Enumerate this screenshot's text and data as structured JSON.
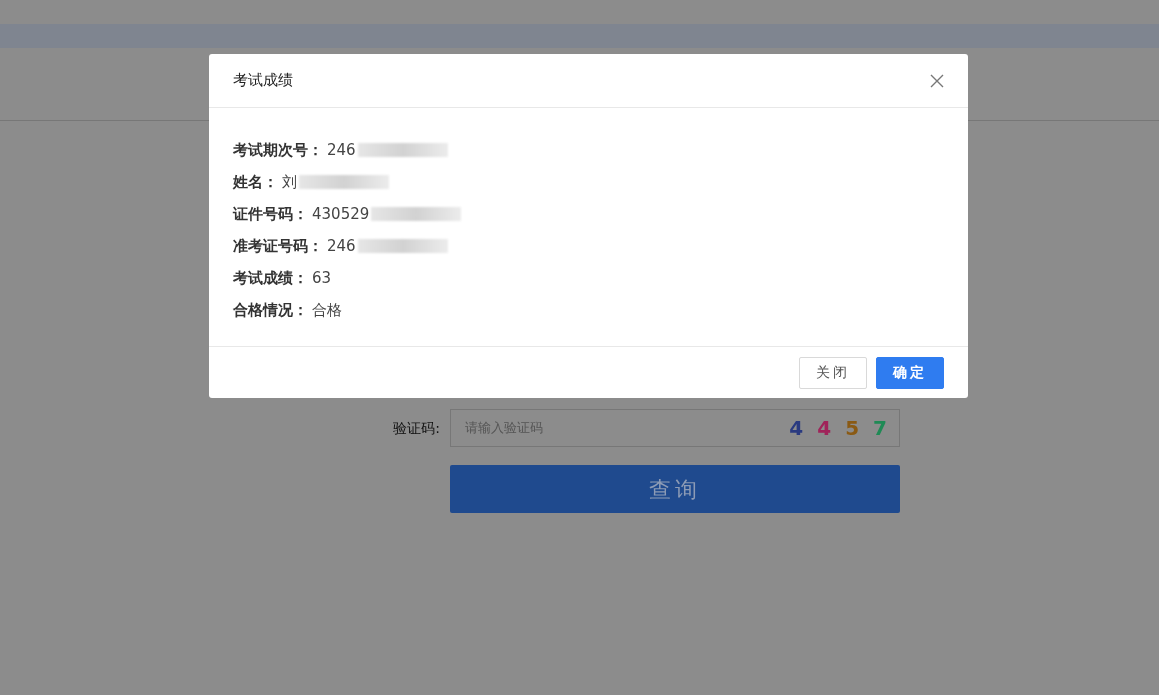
{
  "page": {
    "captcha": {
      "label": "验证码:",
      "placeholder": "请输入验证码",
      "code": [
        {
          "char": "4",
          "color": "#2a3a80"
        },
        {
          "char": "4",
          "color": "#a0245a"
        },
        {
          "char": "5",
          "color": "#8a5a14"
        },
        {
          "char": "7",
          "color": "#1f8a55"
        }
      ]
    },
    "query_button": "查询"
  },
  "dialog": {
    "title": "考试成绩",
    "fields": [
      {
        "label": "考试期次号：",
        "value": "246",
        "masked": true
      },
      {
        "label": "姓名：",
        "value": "刘",
        "masked": true
      },
      {
        "label": "证件号码：",
        "value": "430529",
        "masked": true
      },
      {
        "label": "准考证号码：",
        "value": "246",
        "masked": true
      },
      {
        "label": "考试成绩：",
        "value": "63",
        "masked": false
      },
      {
        "label": "合格情况：",
        "value": "合格",
        "masked": false
      }
    ],
    "buttons": [
      {
        "label": "关闭",
        "kind": "secondary"
      },
      {
        "label": "确定",
        "kind": "primary"
      }
    ]
  }
}
